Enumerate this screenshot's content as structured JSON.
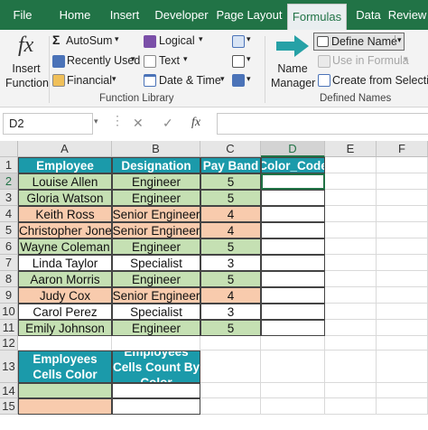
{
  "tabs": [
    "File",
    "Home",
    "Insert",
    "Developer",
    "Page Layout",
    "Formulas",
    "Data",
    "Review"
  ],
  "active_tab": "Formulas",
  "ribbon": {
    "insert_function": "Insert Function",
    "autosum": "AutoSum",
    "recently_used": "Recently Used",
    "financial": "Financial",
    "logical": "Logical",
    "text": "Text",
    "date_time": "Date & Time",
    "function_library": "Function Library",
    "name_manager": "Name Manager",
    "define_name": "Define Name",
    "use_in_formula": "Use in Formula",
    "create_from_selection": "Create from Selection",
    "defined_names": "Defined Names",
    "fx_symbol": "fx"
  },
  "formula_bar": {
    "name_box": "D2",
    "formula": ""
  },
  "columns": [
    "A",
    "B",
    "C",
    "D",
    "E",
    "F"
  ],
  "rows": [
    "1",
    "2",
    "3",
    "4",
    "5",
    "6",
    "7",
    "8",
    "9",
    "10",
    "11",
    "12",
    "13",
    "14",
    "15"
  ],
  "table": {
    "headers": [
      "Employee",
      "Designation",
      "Pay Band",
      "Color_Code"
    ],
    "data": [
      {
        "employee": "Louise Allen",
        "designation": "Engineer",
        "pay_band": "5",
        "color": "green"
      },
      {
        "employee": "Gloria Watson",
        "designation": "Engineer",
        "pay_band": "5",
        "color": "green"
      },
      {
        "employee": "Keith Ross",
        "designation": "Senior Engineer",
        "pay_band": "4",
        "color": "orange"
      },
      {
        "employee": "Christopher Jones",
        "designation": "Senior Engineer",
        "pay_band": "4",
        "color": "orange"
      },
      {
        "employee": "Wayne Coleman",
        "designation": "Engineer",
        "pay_band": "5",
        "color": "green"
      },
      {
        "employee": "Linda Taylor",
        "designation": "Specialist",
        "pay_band": "3",
        "color": "white"
      },
      {
        "employee": "Aaron Morris",
        "designation": "Engineer",
        "pay_band": "5",
        "color": "green"
      },
      {
        "employee": "Judy Cox",
        "designation": "Senior Engineer",
        "pay_band": "4",
        "color": "orange"
      },
      {
        "employee": "Carol Perez",
        "designation": "Specialist",
        "pay_band": "3",
        "color": "white"
      },
      {
        "employee": "Emily Johnson",
        "designation": "Engineer",
        "pay_band": "5",
        "color": "green"
      }
    ]
  },
  "summary": {
    "header_a": "Employees Cells Color",
    "header_b": "Employees Cells Count By Color",
    "rows": [
      {
        "color": "green"
      },
      {
        "color": "orange"
      }
    ]
  },
  "colors": {
    "header_fill": "#1b9aaa",
    "green_fill": "#c5e0b3",
    "orange_fill": "#f8cbad",
    "excel_green": "#217346"
  }
}
